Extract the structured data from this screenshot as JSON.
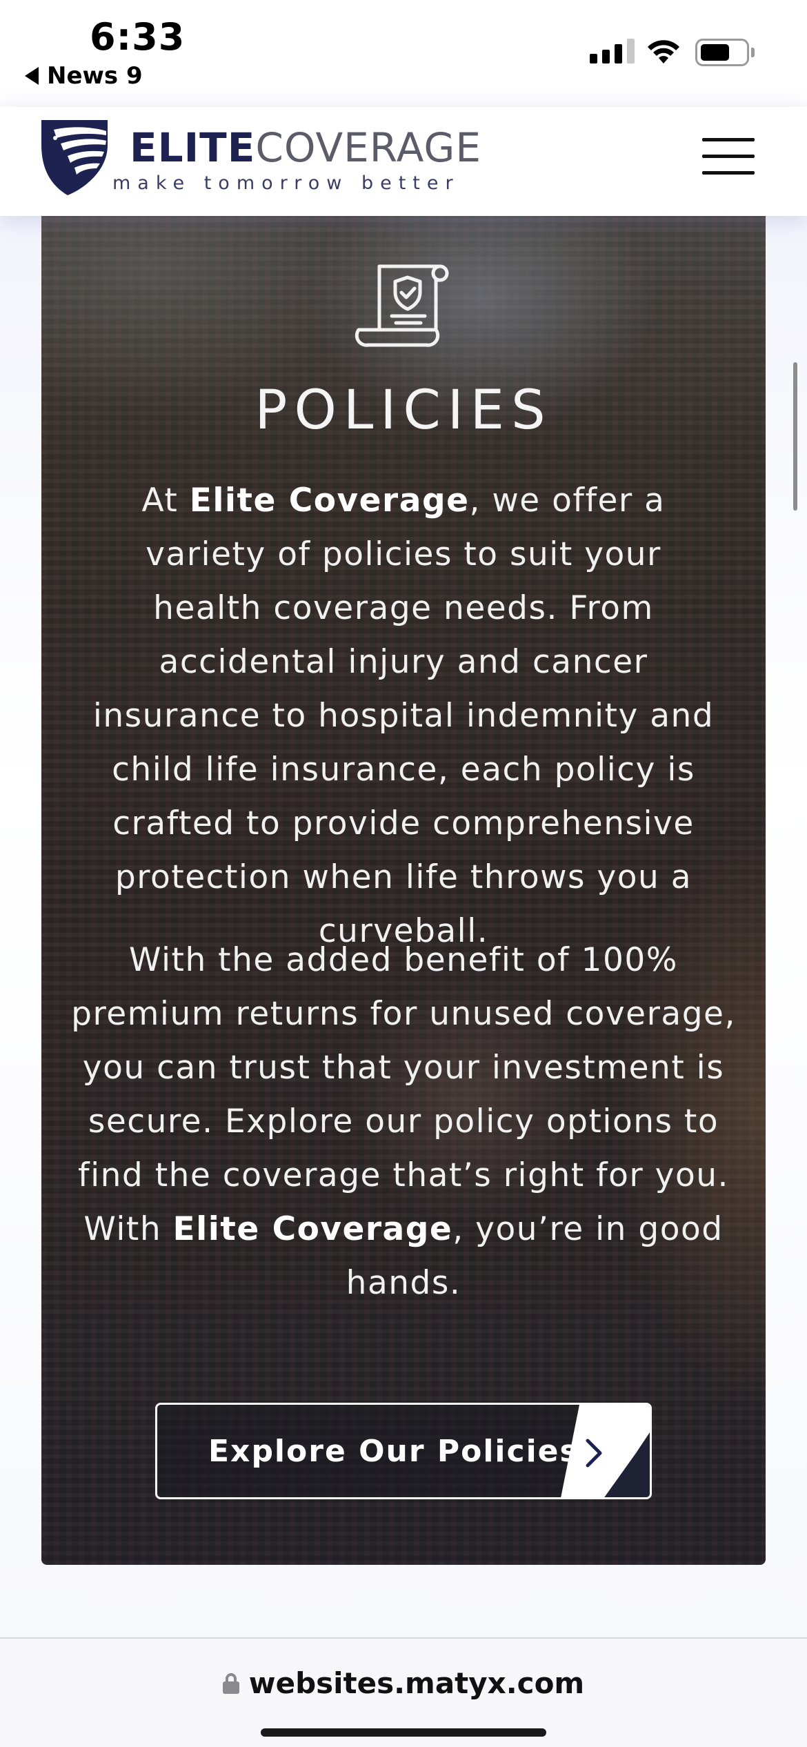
{
  "status_bar": {
    "time": "6:33",
    "back_app": "News 9",
    "signal_bars": {
      "total": 4,
      "active": 3
    },
    "battery_level": 0.62
  },
  "header": {
    "logo_bold": "ELITE",
    "logo_light": "COVERAGE",
    "tagline": "make tomorrow better",
    "brand_color": "#1e2250",
    "menu_icon": "hamburger-icon"
  },
  "hero": {
    "icon": "policy-document-shield-icon",
    "title": "POLICIES",
    "p1": {
      "pre": "At ",
      "brand": "Elite Coverage",
      "post": ", we offer a variety of policies to suit your health coverage needs. From accidental injury and cancer insurance to hospital indemnity and child life insurance, each policy is crafted to provide comprehensive protection when life throws you a curveball."
    },
    "p2": {
      "pre": "With the added benefit of 100% premium returns for unused coverage, you can trust that your investment is secure. Explore our policy options to find the coverage that’s right for you. With ",
      "brand": "Elite Coverage",
      "post": ", you’re in good hands."
    },
    "cta_label": "Explore Our Policies",
    "cta_icon": "chevron-right-icon"
  },
  "browser": {
    "url": "websites.matyx.com",
    "lock_icon": "lock-icon"
  }
}
